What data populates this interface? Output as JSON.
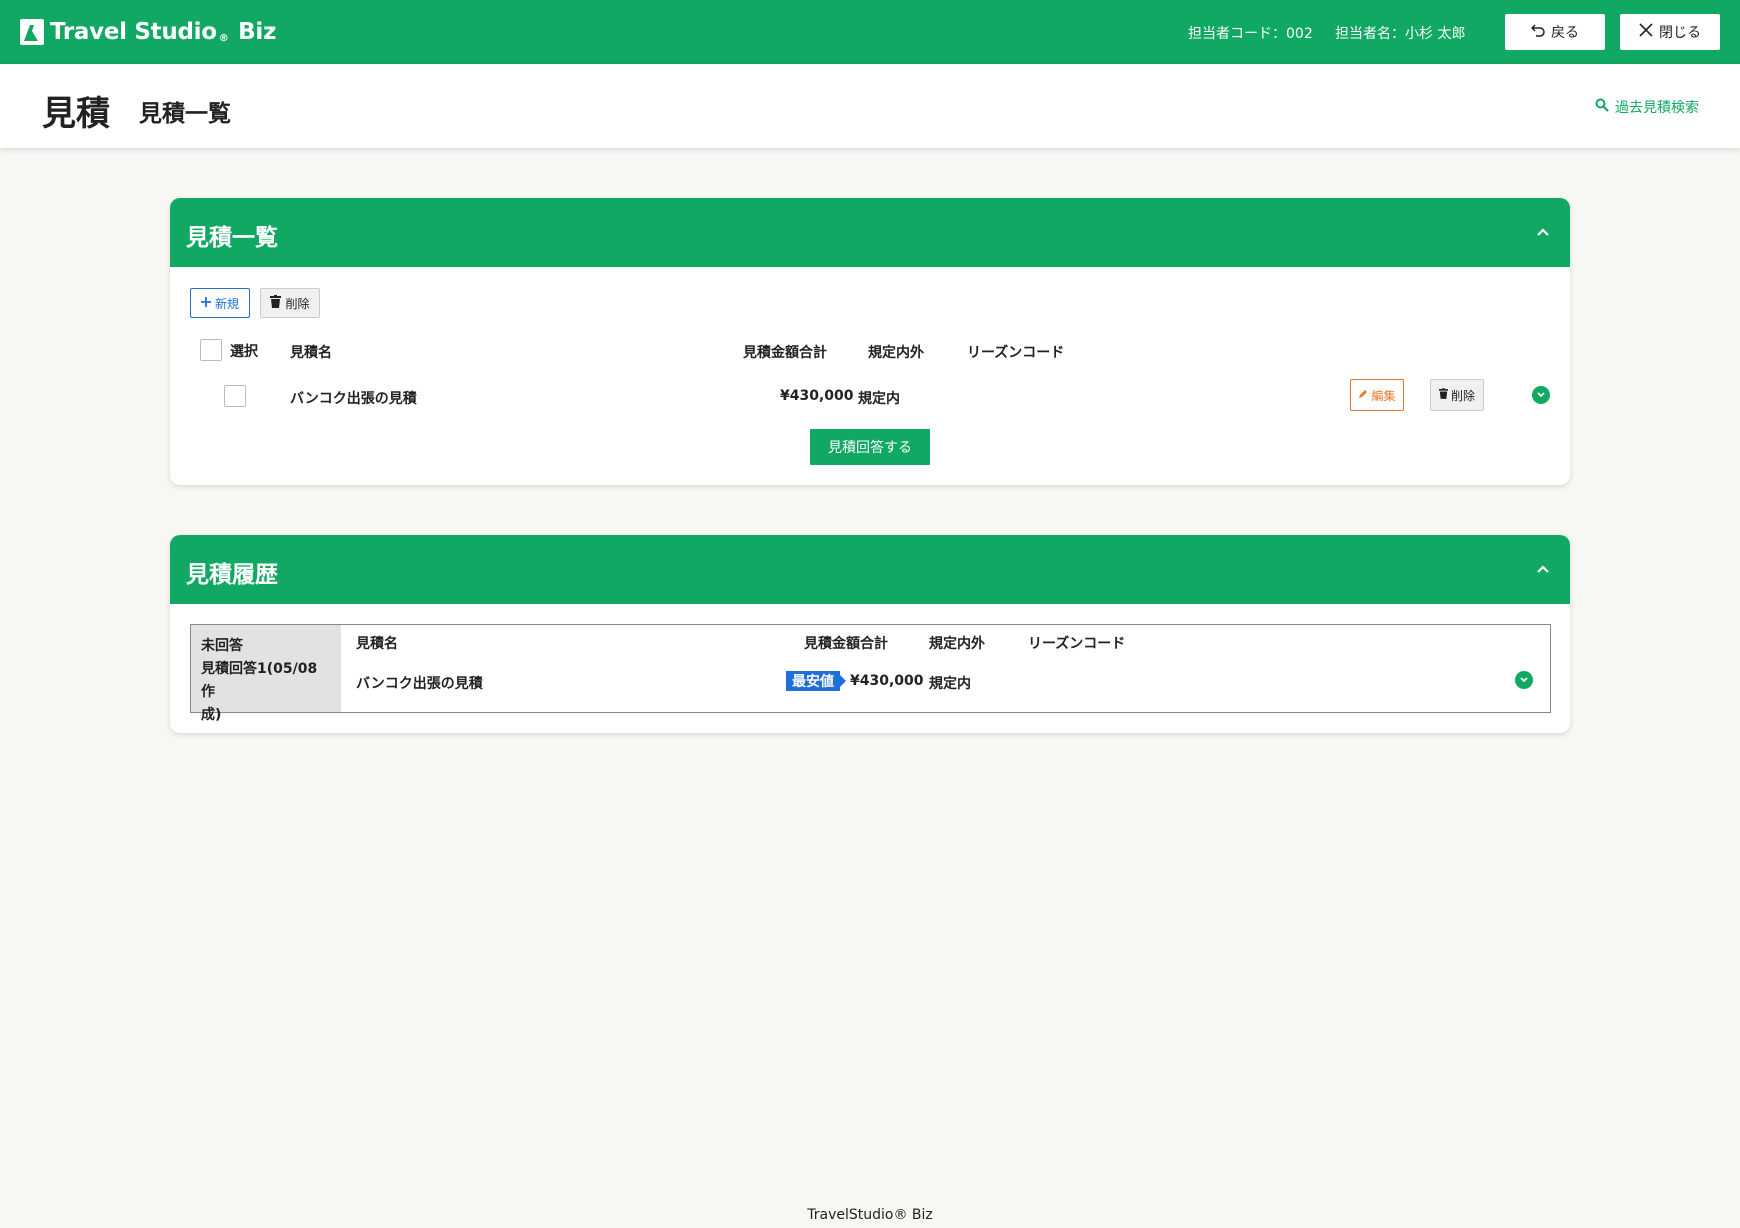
{
  "topbar": {
    "logo_text": "Travel Studio",
    "logo_reg": "®",
    "logo_suffix": "Biz",
    "staff_code": "担当者コード：002",
    "staff_name": "担当者名：小杉 太郎",
    "back_label": "戻る",
    "close_label": "閉じる"
  },
  "page": {
    "title": "見積",
    "subtitle": "見積一覧",
    "search_link": "過去見積検索"
  },
  "list_card": {
    "title": "見積一覧",
    "new_label": "新規",
    "delete_label": "削除",
    "headers": {
      "select": "選択",
      "name": "見積名",
      "total": "見積金額合計",
      "policy": "規定内外",
      "reason": "リーズンコード"
    },
    "rows": [
      {
        "name": "バンコク出張の見積",
        "total": "¥430,000",
        "policy": "規定内",
        "reason": "",
        "edit_label": "編集",
        "delete_label": "削除"
      }
    ],
    "answer_button": "見積回答する"
  },
  "history_card": {
    "title": "見積履歴",
    "status_lines": [
      "未回答",
      "見積回答1(05/08作",
      "成)"
    ],
    "headers": {
      "name": "見積名",
      "total": "見積金額合計",
      "policy": "規定内外",
      "reason": "リーズンコード"
    },
    "row": {
      "name": "バンコク出張の見積",
      "badge": "最安値",
      "total": "¥430,000",
      "policy": "規定内"
    }
  },
  "footer": {
    "text": "TravelStudio® Biz"
  },
  "colors": {
    "brand_green": "#10a863",
    "accent_blue": "#1e6fd9",
    "edit_orange": "#e8762c"
  }
}
